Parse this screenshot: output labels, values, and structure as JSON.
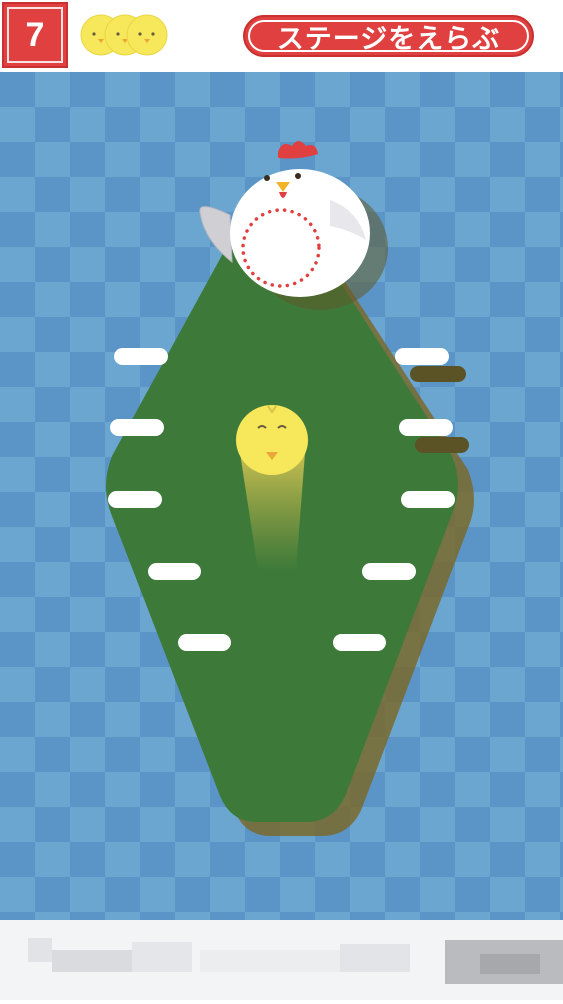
{
  "header": {
    "stage_number": "7",
    "stage_select_label": "ステージをえらぶ",
    "lives_remaining": 3
  },
  "colors": {
    "accent_red": "#e0403f",
    "board_tile_light": "#6fa8d0",
    "board_tile_dark": "#5a93c6",
    "field_green": "#3d7a39",
    "field_shadow": "#6b5f2a",
    "chick_yellow": "#f6e85a",
    "hen_white": "#ffffff"
  },
  "icons": {
    "life": "chick-icon",
    "hen": "hen-icon",
    "player": "chick-icon"
  }
}
